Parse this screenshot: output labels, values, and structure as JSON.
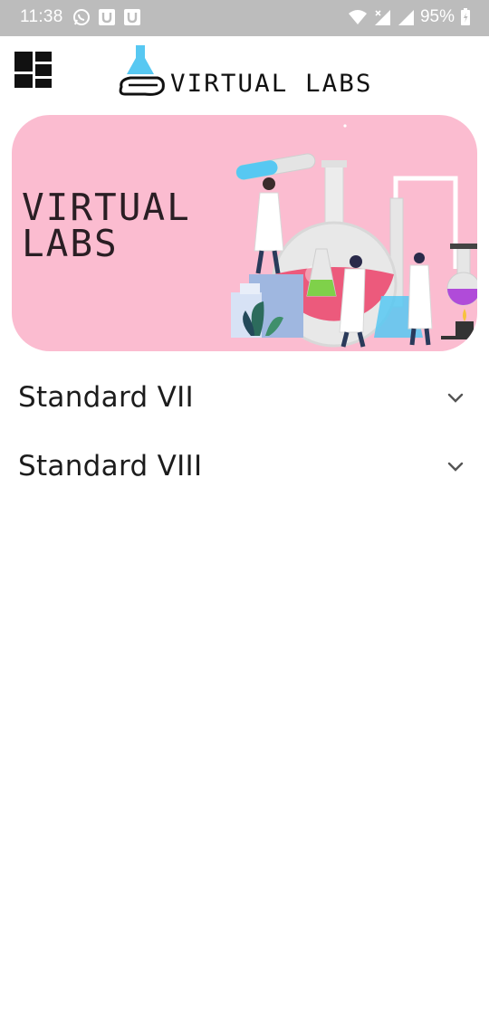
{
  "status_bar": {
    "time": "11:38",
    "battery": "95%",
    "left_icons": [
      "whatsapp-icon",
      "u-app-icon",
      "u-app-icon"
    ],
    "right_icons": [
      "wifi-icon",
      "cell-signal-no-data-icon",
      "cell-signal-icon",
      "battery-charging-icon"
    ]
  },
  "header": {
    "logo_text": "VIRTUAL LABS",
    "menu_icon": "dashboard-grid-icon"
  },
  "banner": {
    "title_line1": "VIRTUAL",
    "title_line2": "LABS",
    "background": "#fbbcd0"
  },
  "accordion": {
    "items": [
      {
        "label": "Standard VII",
        "icon": "chevron-down-icon"
      },
      {
        "label": "Standard VIII",
        "icon": "chevron-down-icon"
      }
    ]
  }
}
